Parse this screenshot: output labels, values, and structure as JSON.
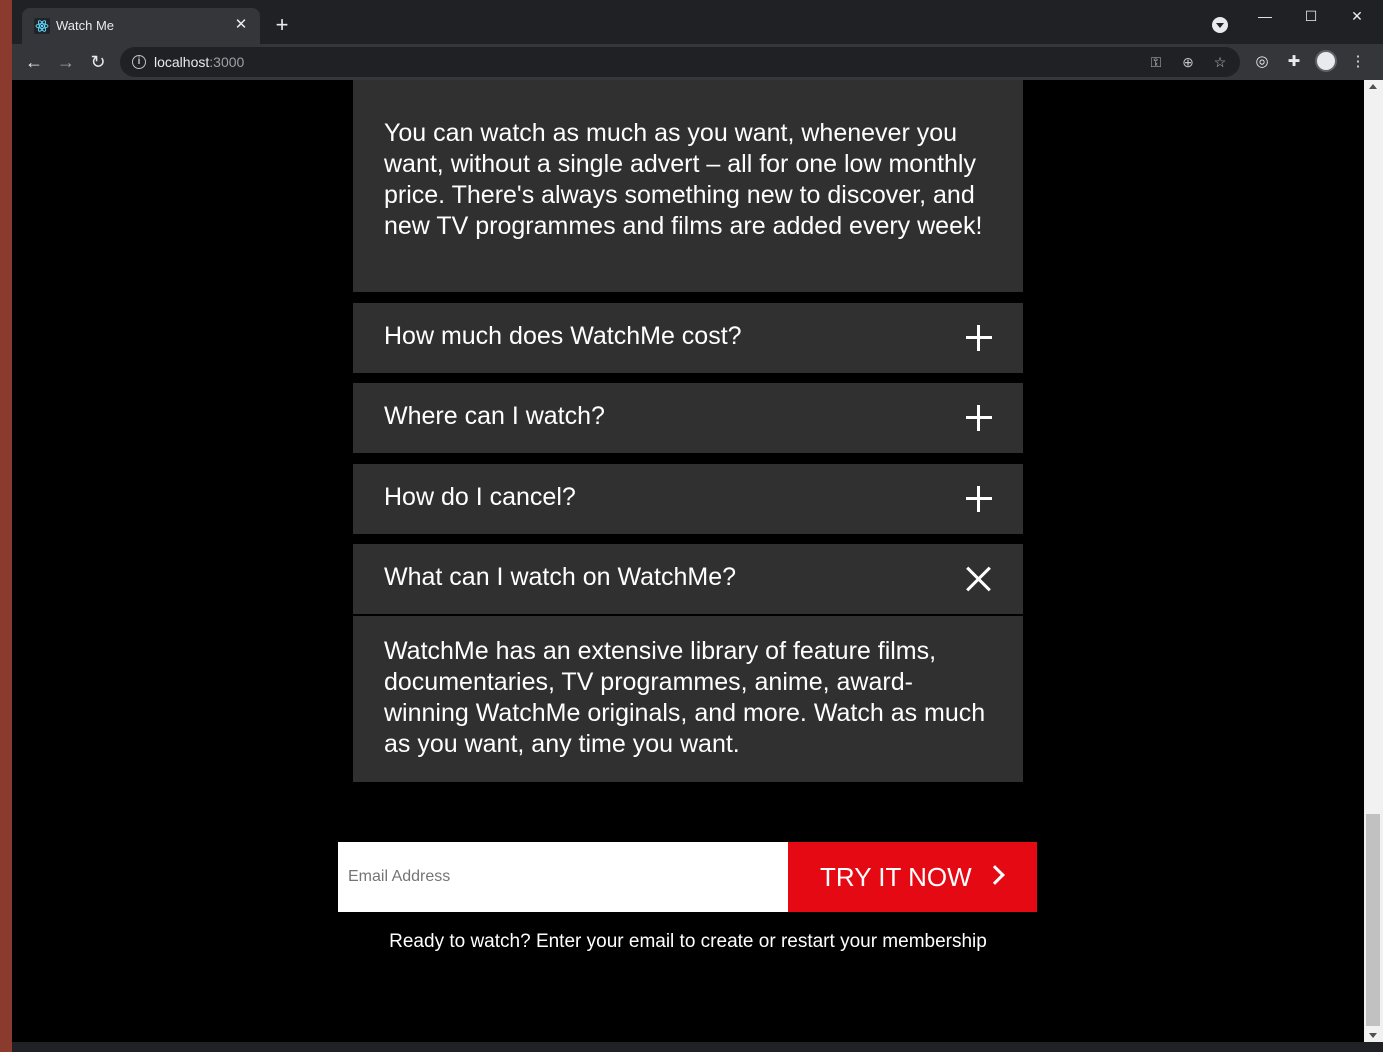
{
  "browser": {
    "tab_title": "Watch Me",
    "tab_close": "✕",
    "new_tab": "+",
    "url_host": "localhost",
    "url_port": ":3000",
    "window_controls": {
      "minimize": "—",
      "maximize": "☐",
      "close": "✕"
    }
  },
  "faq": {
    "expanded_top_answer": "You can watch as much as you want, whenever you want, without a single advert – all for one low monthly price. There's always something new to discover, and new TV programmes and films are added every week!",
    "items": [
      {
        "question": "How much does WatchMe cost?",
        "icon": "plus-icon"
      },
      {
        "question": "Where can I watch?",
        "icon": "plus-icon"
      },
      {
        "question": "How do I cancel?",
        "icon": "plus-icon"
      },
      {
        "question": "What can I watch on WatchMe?",
        "icon": "close-icon"
      }
    ],
    "expanded_answer": " WatchMe has an extensive library of feature films, documentaries, TV programmes, anime, award-winning WatchMe originals, and more. Watch as much as you want, any time you want."
  },
  "signup": {
    "email_placeholder": "Email Address",
    "button_label": "TRY IT NOW",
    "cta_text": "Ready to watch? Enter your email to create or restart your membership"
  },
  "colors": {
    "accent": "#e50914",
    "panel": "#303030",
    "background": "#000000"
  }
}
